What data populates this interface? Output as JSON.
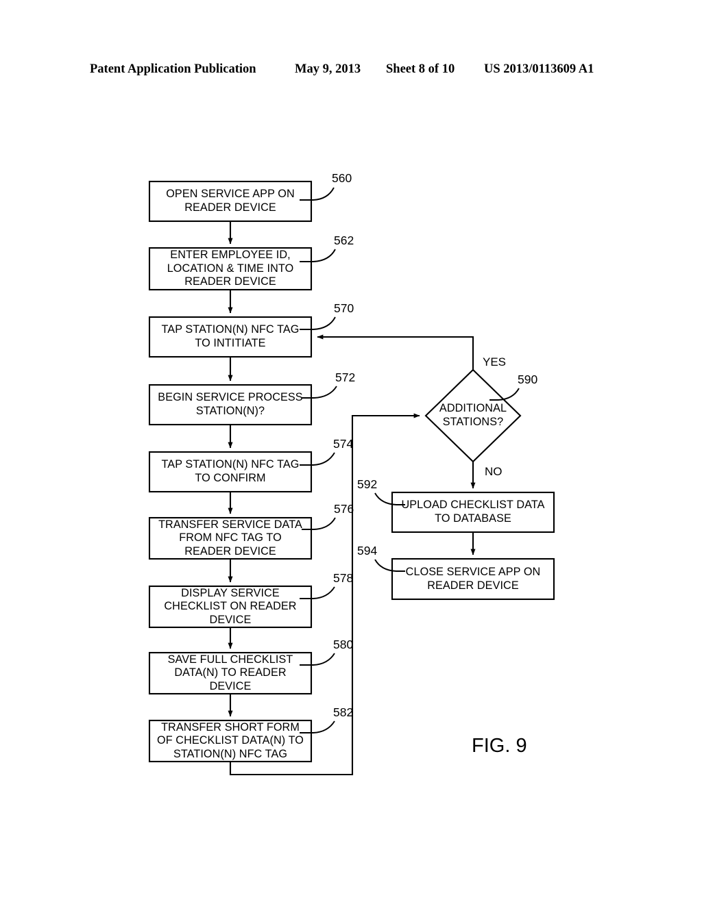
{
  "header": {
    "publication": "Patent Application Publication",
    "date": "May 9, 2013",
    "sheet": "Sheet 8 of 10",
    "patent_number": "US 2013/0113609 A1"
  },
  "figure": {
    "caption": "FIG. 9",
    "nodes": [
      {
        "ref": "560",
        "shape": "process",
        "text": "OPEN SERVICE APP ON\nREADER DEVICE"
      },
      {
        "ref": "562",
        "shape": "process",
        "text": "ENTER EMPLOYEE ID,\nLOCATION & TIME INTO\nREADER DEVICE"
      },
      {
        "ref": "570",
        "shape": "process",
        "text": "TAP STATION(N) NFC TAG\nTO INTITIATE"
      },
      {
        "ref": "572",
        "shape": "process",
        "text": "BEGIN SERVICE PROCESS\nSTATION(N)?"
      },
      {
        "ref": "574",
        "shape": "process",
        "text": "TAP STATION(N) NFC TAG\nTO CONFIRM"
      },
      {
        "ref": "576",
        "shape": "process",
        "text": "TRANSFER SERVICE DATA\nFROM NFC TAG TO\nREADER DEVICE"
      },
      {
        "ref": "578",
        "shape": "process",
        "text": "DISPLAY SERVICE\nCHECKLIST ON READER\nDEVICE"
      },
      {
        "ref": "580",
        "shape": "process",
        "text": "SAVE FULL CHECKLIST\nDATA(N) TO READER\nDEVICE"
      },
      {
        "ref": "582",
        "shape": "process",
        "text": "TRANSFER SHORT FORM\nOF CHECKLIST DATA(N) TO\nSTATION(N) NFC TAG"
      },
      {
        "ref": "590",
        "shape": "decision",
        "text": "ADDITIONAL\nSTATIONS?"
      },
      {
        "ref": "592",
        "shape": "process",
        "text": "UPLOAD CHECKLIST DATA\nTO DATABASE"
      },
      {
        "ref": "594",
        "shape": "process",
        "text": "CLOSE SERVICE APP ON\nREADER DEVICE"
      }
    ],
    "branch_labels": {
      "yes": "YES",
      "no": "NO"
    }
  },
  "colors": {
    "ink": "#000000",
    "paper": "#ffffff"
  }
}
